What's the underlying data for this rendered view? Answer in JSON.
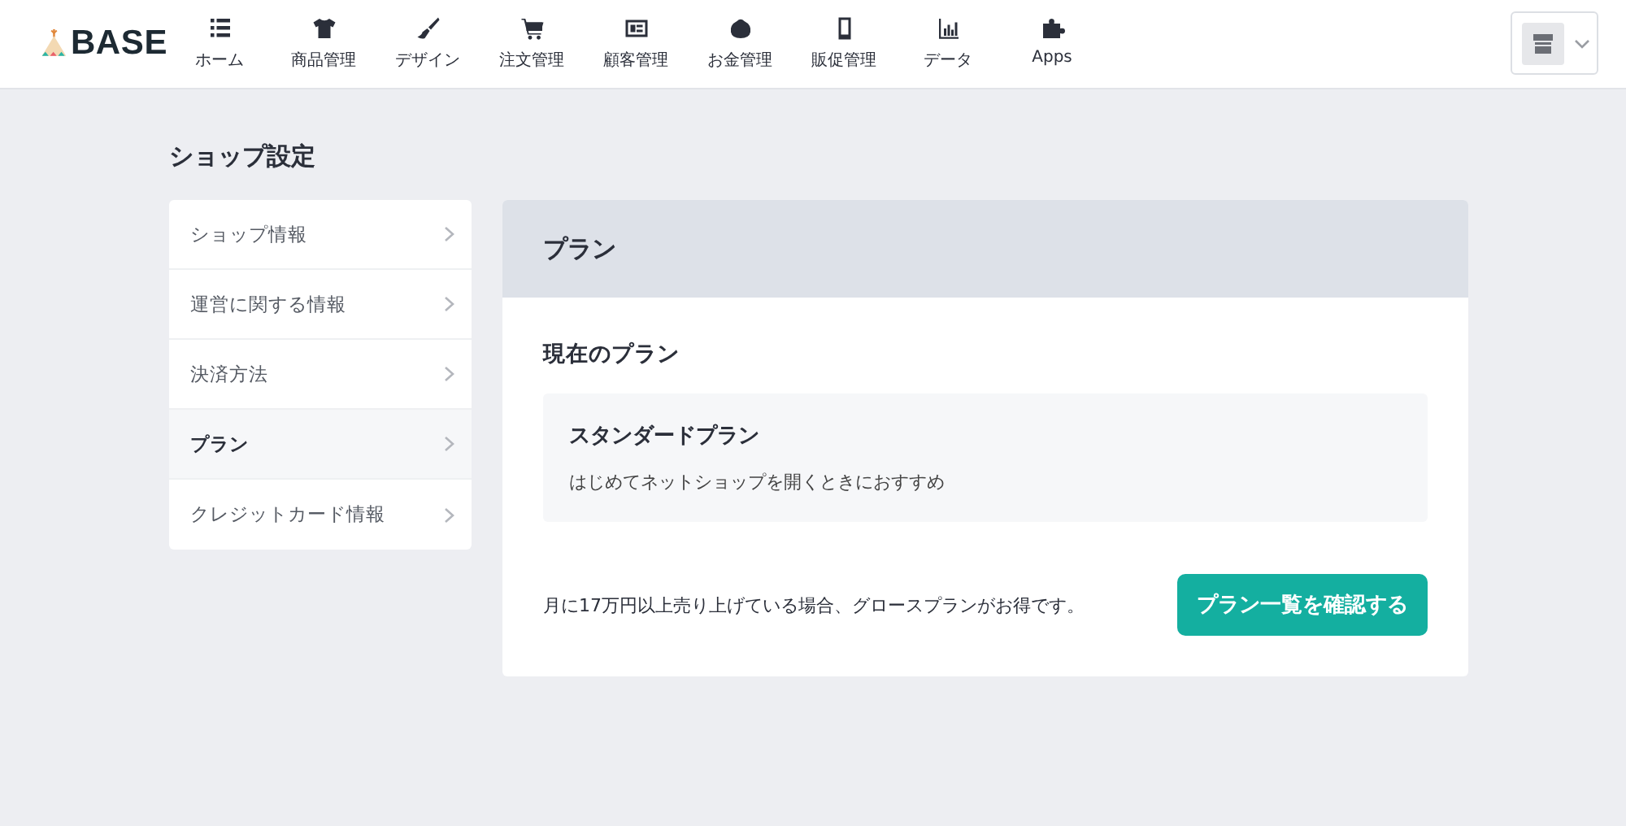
{
  "header": {
    "logo": "BASE",
    "nav": [
      {
        "label": "ホーム"
      },
      {
        "label": "商品管理"
      },
      {
        "label": "デザイン"
      },
      {
        "label": "注文管理"
      },
      {
        "label": "顧客管理"
      },
      {
        "label": "お金管理"
      },
      {
        "label": "販促管理"
      },
      {
        "label": "データ"
      },
      {
        "label": "Apps"
      }
    ]
  },
  "page_title": "ショップ設定",
  "sidebar": {
    "items": [
      {
        "label": "ショップ情報",
        "selected": false
      },
      {
        "label": "運営に関する情報",
        "selected": false
      },
      {
        "label": "決済方法",
        "selected": false
      },
      {
        "label": "プラン",
        "selected": true
      },
      {
        "label": "クレジットカード情報",
        "selected": false
      }
    ]
  },
  "panel": {
    "title": "プラン",
    "section_title": "現在のプラン",
    "plan": {
      "name": "スタンダードプラン",
      "description": "はじめてネットショップを開くときにおすすめ"
    },
    "note": "月に17万円以上売り上げている場合、グロースプランがお得です。",
    "button": "プラン一覧を確認する"
  }
}
